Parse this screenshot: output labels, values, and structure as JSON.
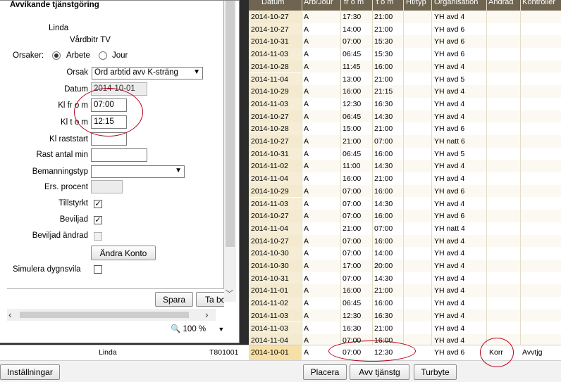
{
  "table": {
    "headers": [
      "Datum",
      "Arb/Jour",
      "fr o m",
      "t o m",
      "Ht/typ",
      "Organisation",
      "Ändrad",
      "Kontroller"
    ],
    "rows": [
      [
        "2014-10-27",
        "A",
        "17:30",
        "21:00",
        "YH avd 4"
      ],
      [
        "2014-10-27",
        "A",
        "14:00",
        "21:00",
        "YH avd 6"
      ],
      [
        "2014-10-31",
        "A",
        "07:00",
        "15:30",
        "YH avd 6"
      ],
      [
        "2014-11-03",
        "A",
        "06:45",
        "15:30",
        "YH avd 6"
      ],
      [
        "2014-10-28",
        "A",
        "11:45",
        "16:00",
        "YH avd 4"
      ],
      [
        "2014-11-04",
        "A",
        "13:00",
        "21:00",
        "YH avd 5"
      ],
      [
        "2014-10-29",
        "A",
        "16:00",
        "21:15",
        "YH avd 4"
      ],
      [
        "2014-11-03",
        "A",
        "12:30",
        "16:30",
        "YH avd 4"
      ],
      [
        "2014-10-27",
        "A",
        "06:45",
        "14:30",
        "YH avd 4"
      ],
      [
        "2014-10-28",
        "A",
        "15:00",
        "21:00",
        "YH avd 6"
      ],
      [
        "2014-10-27",
        "A",
        "21:00",
        "07:00",
        "YH natt 6"
      ],
      [
        "2014-10-31",
        "A",
        "06:45",
        "16:00",
        "YH avd 5"
      ],
      [
        "2014-11-02",
        "A",
        "11:00",
        "14:30",
        "YH avd 4"
      ],
      [
        "2014-11-04",
        "A",
        "16:00",
        "21:00",
        "YH avd 4"
      ],
      [
        "2014-10-29",
        "A",
        "07:00",
        "16:00",
        "YH avd 6"
      ],
      [
        "2014-11-03",
        "A",
        "07:00",
        "14:30",
        "YH avd 4"
      ],
      [
        "2014-10-27",
        "A",
        "07:00",
        "16:00",
        "YH avd 6"
      ],
      [
        "2014-11-04",
        "A",
        "21:00",
        "07:00",
        "YH natt 4"
      ],
      [
        "2014-10-27",
        "A",
        "07:00",
        "16:00",
        "YH avd 4"
      ],
      [
        "2014-10-30",
        "A",
        "07:00",
        "14:00",
        "YH avd 4"
      ],
      [
        "2014-10-30",
        "A",
        "17:00",
        "20:00",
        "YH avd 4"
      ],
      [
        "2014-10-31",
        "A",
        "07:00",
        "14:30",
        "YH avd 4"
      ],
      [
        "2014-11-01",
        "A",
        "16:00",
        "21:00",
        "YH avd 4"
      ],
      [
        "2014-11-02",
        "A",
        "06:45",
        "16:00",
        "YH avd 4"
      ],
      [
        "2014-11-03",
        "A",
        "12:30",
        "16:30",
        "YH avd 4"
      ],
      [
        "2014-11-03",
        "A",
        "16:30",
        "21:00",
        "YH avd 4"
      ],
      [
        "2014-11-04",
        "A",
        "07:00",
        "16:00",
        "YH avd 4"
      ]
    ],
    "linda_row": {
      "name": "Linda",
      "code": "T801001",
      "date": "2014-10-01",
      "type": "A",
      "from": "07:00",
      "to": "12:30",
      "org": "YH avd 6",
      "changed": "Korr",
      "control": "Avvtjg"
    }
  },
  "toolbar": {
    "settings": "Inställningar",
    "place": "Placera",
    "avv": "Avv tjänstg",
    "swap": "Turbyte"
  },
  "dialog": {
    "title": "Avvikande tjänstgöring",
    "person_name": "Linda",
    "person_unit": "Vårdbitr TV",
    "causes_label": "Orsaker:",
    "radio_work": "Arbete",
    "radio_jour": "Jour",
    "reason_label": "Orsak",
    "reason_value": "Ord arbtid avv K-sträng",
    "date_label": "Datum",
    "date_value": "2014-10-01",
    "from_label": "Kl fr o m",
    "from_value": "07:00",
    "to_label": "Kl t o m",
    "to_value": "12:15",
    "break_start_label": "Kl raststart",
    "break_min_label": "Rast antal min",
    "staffing_label": "Bemanningstyp",
    "ers_label": "Ers. procent",
    "tillstyrkt_label": "Tillstyrkt",
    "beviljad_label": "Beviljad",
    "beviljad_andrad_label": "Beviljad ändrad",
    "change_account": "Ändra Konto",
    "simulate_label": "Simulera dygnsvila",
    "save": "Spara",
    "remove": "Ta bort",
    "zoom": "100 %"
  }
}
